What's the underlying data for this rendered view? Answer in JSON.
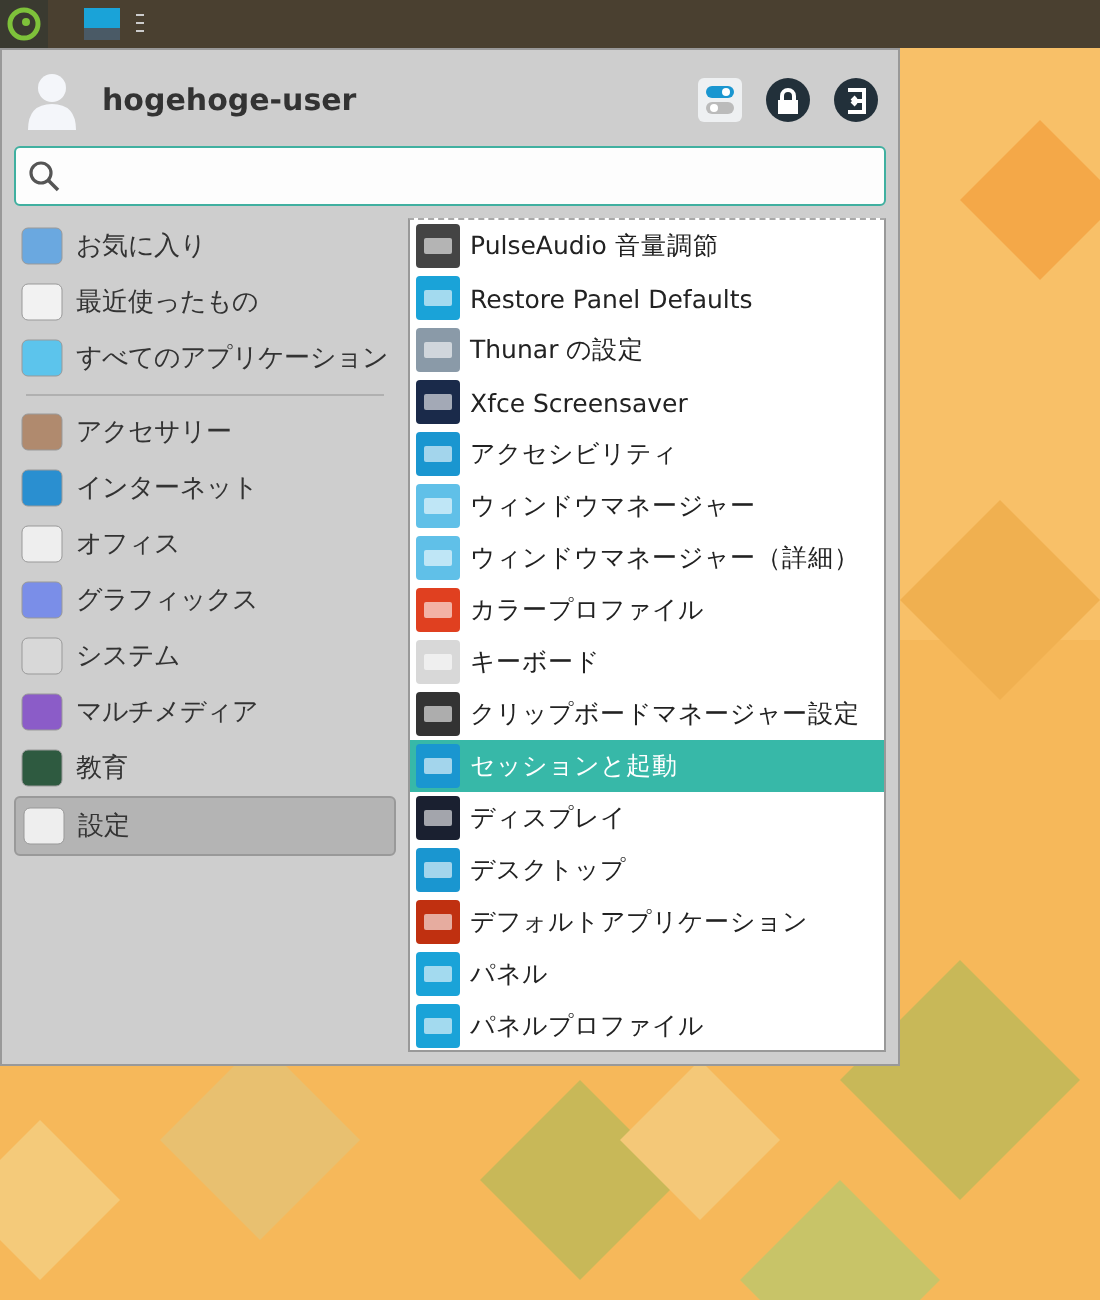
{
  "menu": {
    "user": {
      "name": "hogehoge-user"
    },
    "places": [
      {
        "label": "お気に入り",
        "selected": false
      },
      {
        "label": "最近使ったもの",
        "selected": false
      },
      {
        "label": "すべてのアプリケーション",
        "selected": false
      }
    ],
    "categories": [
      {
        "label": "アクセサリー",
        "selected": false
      },
      {
        "label": "インターネット",
        "selected": false
      },
      {
        "label": "オフィス",
        "selected": false
      },
      {
        "label": "グラフィックス",
        "selected": false
      },
      {
        "label": "システム",
        "selected": false
      },
      {
        "label": "マルチメディア",
        "selected": false
      },
      {
        "label": "教育",
        "selected": false
      },
      {
        "label": "設定",
        "selected": true
      }
    ],
    "apps": [
      {
        "label": "PulseAudio 音量調節",
        "selected": false
      },
      {
        "label": "Restore Panel Defaults",
        "selected": false
      },
      {
        "label": "Thunar の設定",
        "selected": false
      },
      {
        "label": "Xfce Screensaver",
        "selected": false
      },
      {
        "label": "アクセシビリティ",
        "selected": false
      },
      {
        "label": "ウィンドウマネージャー",
        "selected": false
      },
      {
        "label": "ウィンドウマネージャー（詳細）",
        "selected": false
      },
      {
        "label": "カラープロファイル",
        "selected": false
      },
      {
        "label": "キーボード",
        "selected": false
      },
      {
        "label": "クリップボードマネージャー設定",
        "selected": false
      },
      {
        "label": "セッションと起動",
        "selected": true
      },
      {
        "label": "ディスプレイ",
        "selected": false
      },
      {
        "label": "デスクトップ",
        "selected": false
      },
      {
        "label": "デフォルトアプリケーション",
        "selected": false
      },
      {
        "label": "パネル",
        "selected": false
      },
      {
        "label": "パネルプロファイル",
        "selected": false
      }
    ]
  }
}
